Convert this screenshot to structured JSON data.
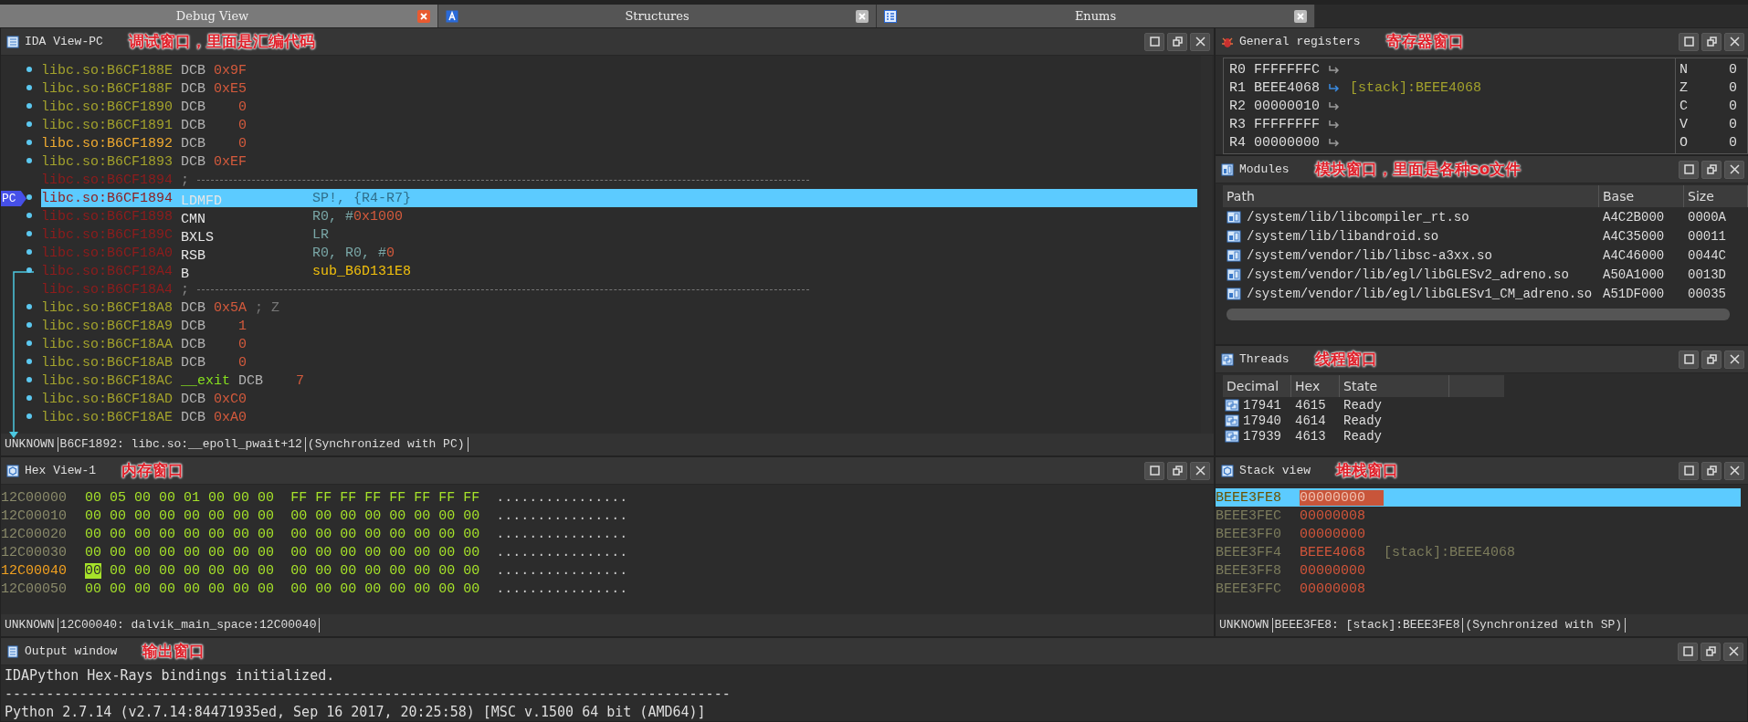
{
  "tabs": [
    {
      "label": "Debug View",
      "kind": "plain",
      "selected": true
    },
    {
      "label": "Structures",
      "kind": "structures",
      "selected": false
    },
    {
      "label": "Enums",
      "kind": "enums",
      "selected": false
    }
  ],
  "ida_view": {
    "title": "IDA View-PC",
    "annotation": "调试窗口，里面是汇编代码",
    "lines": [
      {
        "kind": "data",
        "address": "libc.so:B6CF188E",
        "mnemonic": "DCB",
        "operand": [
          {
            "text": "0x9F",
            "kind": "num"
          }
        ],
        "selected": false,
        "jump": false
      },
      {
        "kind": "data",
        "address": "libc.so:B6CF188F",
        "mnemonic": "DCB",
        "operand": [
          {
            "text": "0xE5",
            "kind": "num"
          }
        ],
        "selected": false,
        "jump": false
      },
      {
        "kind": "data",
        "address": "libc.so:B6CF1890",
        "mnemonic": "DCB",
        "operand": [
          {
            "text": "0",
            "kind": "num"
          }
        ],
        "selected": false,
        "jump": false
      },
      {
        "kind": "data",
        "address": "libc.so:B6CF1891",
        "mnemonic": "DCB",
        "operand": [
          {
            "text": "0",
            "kind": "num"
          }
        ],
        "selected": false,
        "jump": false
      },
      {
        "kind": "cursor",
        "address": "libc.so:B6CF1892",
        "mnemonic": "DCB",
        "operand": [
          {
            "text": "0",
            "kind": "num"
          }
        ],
        "selected": false,
        "jump": false
      },
      {
        "kind": "data",
        "address": "libc.so:B6CF1893",
        "mnemonic": "DCB",
        "operand": [
          {
            "text": "0xEF",
            "kind": "num"
          }
        ],
        "selected": false,
        "jump": false
      },
      {
        "kind": "separator",
        "address": "libc.so:B6CF1894",
        "comment": ";",
        "selected": false,
        "jump": false
      },
      {
        "kind": "code",
        "address": "libc.so:B6CF1894",
        "mnemonic": "LDMFD",
        "operand": [
          {
            "text": "SP!, {R4-R7}",
            "kind": "reg"
          }
        ],
        "pc_marker": "PC",
        "selected": true,
        "jump": false
      },
      {
        "kind": "code",
        "address": "libc.so:B6CF1898",
        "mnemonic": "CMN",
        "operand": [
          {
            "text": "R0, #",
            "kind": "reg"
          },
          {
            "text": "0x1000",
            "kind": "num"
          }
        ],
        "selected": false,
        "jump": false
      },
      {
        "kind": "code",
        "address": "libc.so:B6CF189C",
        "mnemonic": "BXLS",
        "operand": [
          {
            "text": "LR",
            "kind": "reg"
          }
        ],
        "selected": false,
        "jump": false
      },
      {
        "kind": "code",
        "address": "libc.so:B6CF18A0",
        "mnemonic": "RSB",
        "operand": [
          {
            "text": "R0, R0, #",
            "kind": "reg"
          },
          {
            "text": "0",
            "kind": "num"
          }
        ],
        "selected": false,
        "jump": false
      },
      {
        "kind": "code",
        "address": "libc.so:B6CF18A4",
        "mnemonic": "B",
        "operand": [
          {
            "text": "sub_B6D131E8",
            "kind": "name"
          }
        ],
        "selected": false,
        "jump": true
      },
      {
        "kind": "separator",
        "address": "libc.so:B6CF18A4",
        "comment": ";",
        "selected": false,
        "jump": false
      },
      {
        "kind": "data",
        "address": "libc.so:B6CF18A8",
        "mnemonic": "DCB",
        "operand": [
          {
            "text": "0x5A",
            "kind": "num"
          }
        ],
        "comment": "; Z",
        "selected": false,
        "jump": false
      },
      {
        "kind": "data",
        "address": "libc.so:B6CF18A9",
        "mnemonic": "DCB",
        "operand": [
          {
            "text": "1",
            "kind": "num"
          }
        ],
        "selected": false,
        "jump": false
      },
      {
        "kind": "data",
        "address": "libc.so:B6CF18AA",
        "mnemonic": "DCB",
        "operand": [
          {
            "text": "0",
            "kind": "num"
          }
        ],
        "selected": false,
        "jump": false
      },
      {
        "kind": "data",
        "address": "libc.so:B6CF18AB",
        "mnemonic": "DCB",
        "operand": [
          {
            "text": "0",
            "kind": "num"
          }
        ],
        "selected": false,
        "jump": false
      },
      {
        "kind": "data",
        "address": "libc.so:B6CF18AC",
        "label": "__exit",
        "mnemonic": "DCB",
        "operand": [
          {
            "text": "7",
            "kind": "num"
          }
        ],
        "selected": false,
        "jump": false
      },
      {
        "kind": "data",
        "address": "libc.so:B6CF18AD",
        "mnemonic": "DCB",
        "operand": [
          {
            "text": "0xC0",
            "kind": "num"
          }
        ],
        "selected": false,
        "jump": false
      },
      {
        "kind": "data",
        "address": "libc.so:B6CF18AE",
        "mnemonic": "DCB",
        "operand": [
          {
            "text": "0xA0",
            "kind": "num"
          }
        ],
        "selected": false,
        "jump": false
      }
    ],
    "status": {
      "mode": "UNKNOWN",
      "location": "B6CF1892: libc.so:__epoll_pwait+12",
      "sync": "(Synchronized with PC)"
    }
  },
  "registers": {
    "title": "General registers",
    "annotation": "寄存器窗口",
    "rows": [
      {
        "name": "R0",
        "value": "FFFFFFFC"
      },
      {
        "name": "R1",
        "value": "BEEE4068",
        "comment": "[stack]:BEEE4068"
      },
      {
        "name": "R2",
        "value": "00000010"
      },
      {
        "name": "R3",
        "value": "FFFFFFFF"
      },
      {
        "name": "R4",
        "value": "00000000"
      }
    ],
    "flags": [
      {
        "name": "N",
        "value": "0"
      },
      {
        "name": "Z",
        "value": "0"
      },
      {
        "name": "C",
        "value": "0"
      },
      {
        "name": "V",
        "value": "0"
      },
      {
        "name": "O",
        "value": "0"
      }
    ]
  },
  "modules": {
    "title": "Modules",
    "annotation": "模块窗口，里面是各种so文件",
    "columns": [
      "Path",
      "Base",
      "Size"
    ],
    "rows": [
      {
        "path": "/system/lib/libcompiler_rt.so",
        "base": "A4C2B000",
        "size": "0000A"
      },
      {
        "path": "/system/lib/libandroid.so",
        "base": "A4C35000",
        "size": "00011"
      },
      {
        "path": "/system/vendor/lib/libsc-a3xx.so",
        "base": "A4C46000",
        "size": "0044C"
      },
      {
        "path": "/system/vendor/lib/egl/libGLESv2_adreno.so",
        "base": "A50A1000",
        "size": "0013D"
      },
      {
        "path": "/system/vendor/lib/egl/libGLESv1_CM_adreno.so",
        "base": "A51DF000",
        "size": "00035"
      }
    ]
  },
  "threads": {
    "title": "Threads",
    "annotation": "线程窗口",
    "columns": [
      "Decimal",
      "Hex",
      "State"
    ],
    "rows": [
      {
        "decimal": "17941",
        "hex": "4615",
        "state": "Ready"
      },
      {
        "decimal": "17940",
        "hex": "4614",
        "state": "Ready"
      },
      {
        "decimal": "17939",
        "hex": "4613",
        "state": "Ready"
      }
    ]
  },
  "hex_view": {
    "title": "Hex View-1",
    "annotation": "内存窗口",
    "rows": [
      {
        "address": "12C00000",
        "current": false,
        "ascii": "................",
        "bytes": [
          {
            "text": "00",
            "selected": false
          },
          {
            "text": "05",
            "selected": false
          },
          {
            "text": "00",
            "selected": false
          },
          {
            "text": "00",
            "selected": false
          },
          {
            "text": "01",
            "selected": false
          },
          {
            "text": "00",
            "selected": false
          },
          {
            "text": "00",
            "selected": false
          },
          {
            "text": "00",
            "selected": false
          },
          {
            "text": "FF",
            "selected": false
          },
          {
            "text": "FF",
            "selected": false
          },
          {
            "text": "FF",
            "selected": false
          },
          {
            "text": "FF",
            "selected": false
          },
          {
            "text": "FF",
            "selected": false
          },
          {
            "text": "FF",
            "selected": false
          },
          {
            "text": "FF",
            "selected": false
          },
          {
            "text": "FF",
            "selected": false
          }
        ]
      },
      {
        "address": "12C00010",
        "current": false,
        "ascii": "................",
        "bytes": [
          {
            "text": "00",
            "selected": false
          },
          {
            "text": "00",
            "selected": false
          },
          {
            "text": "00",
            "selected": false
          },
          {
            "text": "00",
            "selected": false
          },
          {
            "text": "00",
            "selected": false
          },
          {
            "text": "00",
            "selected": false
          },
          {
            "text": "00",
            "selected": false
          },
          {
            "text": "00",
            "selected": false
          },
          {
            "text": "00",
            "selected": false
          },
          {
            "text": "00",
            "selected": false
          },
          {
            "text": "00",
            "selected": false
          },
          {
            "text": "00",
            "selected": false
          },
          {
            "text": "00",
            "selected": false
          },
          {
            "text": "00",
            "selected": false
          },
          {
            "text": "00",
            "selected": false
          },
          {
            "text": "00",
            "selected": false
          }
        ]
      },
      {
        "address": "12C00020",
        "current": false,
        "ascii": "................",
        "bytes": [
          {
            "text": "00",
            "selected": false
          },
          {
            "text": "00",
            "selected": false
          },
          {
            "text": "00",
            "selected": false
          },
          {
            "text": "00",
            "selected": false
          },
          {
            "text": "00",
            "selected": false
          },
          {
            "text": "00",
            "selected": false
          },
          {
            "text": "00",
            "selected": false
          },
          {
            "text": "00",
            "selected": false
          },
          {
            "text": "00",
            "selected": false
          },
          {
            "text": "00",
            "selected": false
          },
          {
            "text": "00",
            "selected": false
          },
          {
            "text": "00",
            "selected": false
          },
          {
            "text": "00",
            "selected": false
          },
          {
            "text": "00",
            "selected": false
          },
          {
            "text": "00",
            "selected": false
          },
          {
            "text": "00",
            "selected": false
          }
        ]
      },
      {
        "address": "12C00030",
        "current": false,
        "ascii": "................",
        "bytes": [
          {
            "text": "00",
            "selected": false
          },
          {
            "text": "00",
            "selected": false
          },
          {
            "text": "00",
            "selected": false
          },
          {
            "text": "00",
            "selected": false
          },
          {
            "text": "00",
            "selected": false
          },
          {
            "text": "00",
            "selected": false
          },
          {
            "text": "00",
            "selected": false
          },
          {
            "text": "00",
            "selected": false
          },
          {
            "text": "00",
            "selected": false
          },
          {
            "text": "00",
            "selected": false
          },
          {
            "text": "00",
            "selected": false
          },
          {
            "text": "00",
            "selected": false
          },
          {
            "text": "00",
            "selected": false
          },
          {
            "text": "00",
            "selected": false
          },
          {
            "text": "00",
            "selected": false
          },
          {
            "text": "00",
            "selected": false
          }
        ]
      },
      {
        "address": "12C00040",
        "current": true,
        "ascii": "................",
        "bytes": [
          {
            "text": "00",
            "selected": true
          },
          {
            "text": "00",
            "selected": false
          },
          {
            "text": "00",
            "selected": false
          },
          {
            "text": "00",
            "selected": false
          },
          {
            "text": "00",
            "selected": false
          },
          {
            "text": "00",
            "selected": false
          },
          {
            "text": "00",
            "selected": false
          },
          {
            "text": "00",
            "selected": false
          },
          {
            "text": "00",
            "selected": false
          },
          {
            "text": "00",
            "selected": false
          },
          {
            "text": "00",
            "selected": false
          },
          {
            "text": "00",
            "selected": false
          },
          {
            "text": "00",
            "selected": false
          },
          {
            "text": "00",
            "selected": false
          },
          {
            "text": "00",
            "selected": false
          },
          {
            "text": "00",
            "selected": false
          }
        ]
      },
      {
        "address": "12C00050",
        "current": false,
        "ascii": "................",
        "bytes": [
          {
            "text": "00",
            "selected": false
          },
          {
            "text": "00",
            "selected": false
          },
          {
            "text": "00",
            "selected": false
          },
          {
            "text": "00",
            "selected": false
          },
          {
            "text": "00",
            "selected": false
          },
          {
            "text": "00",
            "selected": false
          },
          {
            "text": "00",
            "selected": false
          },
          {
            "text": "00",
            "selected": false
          },
          {
            "text": "00",
            "selected": false
          },
          {
            "text": "00",
            "selected": false
          },
          {
            "text": "00",
            "selected": false
          },
          {
            "text": "00",
            "selected": false
          },
          {
            "text": "00",
            "selected": false
          },
          {
            "text": "00",
            "selected": false
          },
          {
            "text": "00",
            "selected": false
          },
          {
            "text": "00",
            "selected": false
          }
        ]
      }
    ],
    "status": {
      "mode": "UNKNOWN",
      "location": "12C00040: dalvik_main_space:12C00040"
    }
  },
  "stack_view": {
    "title": "Stack view",
    "annotation": "堆栈窗口",
    "rows": [
      {
        "address": "BEEE3FE8",
        "value": "00000000",
        "selected": true
      },
      {
        "address": "BEEE3FEC",
        "value": "00000008",
        "selected": false
      },
      {
        "address": "BEEE3FF0",
        "value": "00000000",
        "selected": false
      },
      {
        "address": "BEEE3FF4",
        "value": "BEEE4068",
        "comment": "[stack]:BEEE4068",
        "selected": false
      },
      {
        "address": "BEEE3FF8",
        "value": "00000000",
        "selected": false
      },
      {
        "address": "BEEE3FFC",
        "value": "00000008",
        "selected": false
      }
    ],
    "status": {
      "mode": "UNKNOWN",
      "location": "BEEE3FE8: [stack]:BEEE3FE8",
      "sync": "(Synchronized with SP)"
    }
  },
  "output": {
    "title": "Output window",
    "annotation": "输出窗口",
    "lines": [
      "IDAPython Hex-Rays bindings initialized.",
      "----------------------------------------------------------------------------------------",
      "Python 2.7.14 (v2.7.14:84471935ed, Sep 16 2017, 20:25:58) [MSC v.1500 64 bit (AMD64)]"
    ]
  }
}
